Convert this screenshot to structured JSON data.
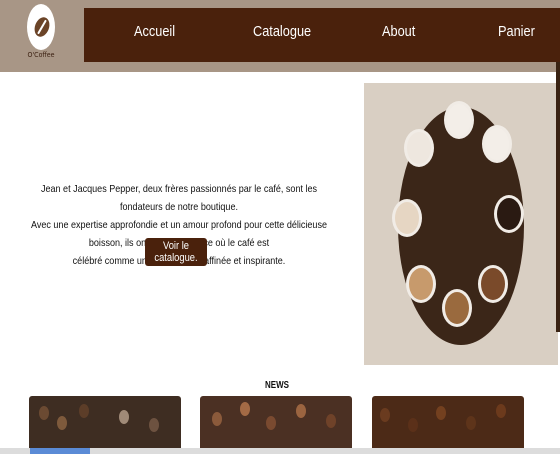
{
  "brand": {
    "logo_text": "O'Coffee"
  },
  "nav": {
    "items": [
      "Accueil",
      "Catalogue",
      "About",
      "Panier"
    ]
  },
  "hero": {
    "lines": [
      "Jean et Jacques Pepper, deux frères passionnés par le café, sont les fondateurs de notre boutique.",
      "Avec une expertise approfondie et un amour profond pour cette délicieuse boisson, ils ont créé un espace où le café est",
      "célébré comme une expérience raffinée et inspirante."
    ],
    "button_label": "Voir le catalogue."
  },
  "news": {
    "title": "NEWS"
  },
  "colors": {
    "brand_dark": "#4a210c",
    "header_bg": "#a89686"
  }
}
